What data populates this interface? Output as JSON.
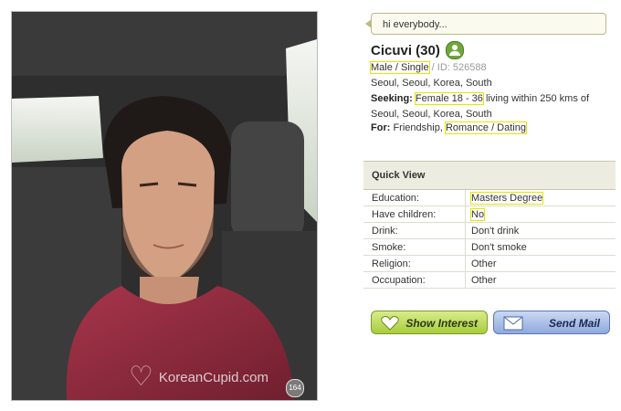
{
  "photo": {
    "watermark": "KoreanCupid.com",
    "photo_count": "164"
  },
  "profile": {
    "headline": "hi everybody...",
    "name_age": "Cicuvi (30)",
    "gender_status": "Male / Single",
    "id_label": "/ ID: 526588",
    "location": "Seoul, Seoul, Korea, South",
    "seeking_label": "Seeking:",
    "seeking_value": "Female 18 - 36",
    "seeking_rest": "living within 250 kms of",
    "seeking_location": "Seoul, Seoul, Korea, South",
    "for_label": "For:",
    "for_value_1": "Friendship,",
    "for_value_2": "Romance / Dating"
  },
  "quick_view": {
    "title": "Quick View",
    "rows": [
      {
        "label": "Education:",
        "value": "Masters Degree"
      },
      {
        "label": "Have children:",
        "value": "No"
      },
      {
        "label": "Drink:",
        "value": "Don't drink"
      },
      {
        "label": "Smoke:",
        "value": "Don't smoke"
      },
      {
        "label": "Religion:",
        "value": "Other"
      },
      {
        "label": "Occupation:",
        "value": "Other"
      }
    ]
  },
  "actions": {
    "show_interest": "Show Interest",
    "send_mail": "Send Mail"
  },
  "colors": {
    "highlight": "#e6e600",
    "online": "#6fa83a",
    "interest_button": "#a9cc3e",
    "mail_button": "#8fa9de"
  }
}
